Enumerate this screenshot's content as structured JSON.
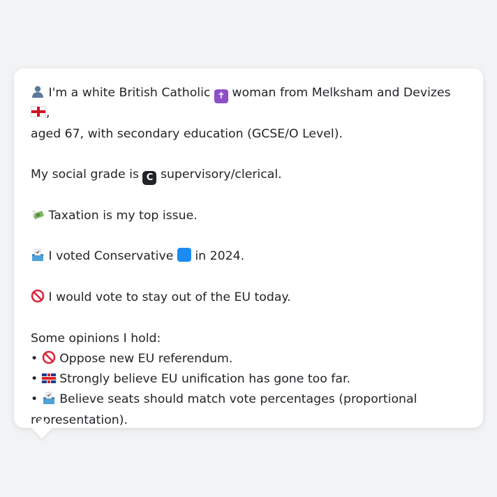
{
  "intro": {
    "person_icon": "person-silhouette-icon",
    "before_cross": "I'm a white British Catholic",
    "cross_icon": "latin-cross-icon",
    "after_cross": "woman from Melksham and Devizes",
    "flag_icon": "england-flag-icon",
    "after_flag": ",",
    "line2": "aged 67, with secondary education (GCSE/O Level)."
  },
  "social_grade": {
    "prefix": "My social grade is",
    "badge_letter": "C",
    "suffix": "supervisory/clerical."
  },
  "issue": {
    "icon": "money-with-wings-icon",
    "text": "Taxation is my top issue."
  },
  "vote": {
    "icon": "ballot-box-icon",
    "prefix": "I voted Conservative",
    "square_icon": "blue-square-icon",
    "suffix": "in 2024."
  },
  "eu": {
    "icon": "no-entry-icon",
    "text": "I would vote to stay out of the EU today."
  },
  "opinions": {
    "heading": "Some opinions I hold:",
    "bullet": "•",
    "items": [
      {
        "icon": "no-entry-icon",
        "text": "Oppose new EU referendum."
      },
      {
        "icon": "uk-flag-icon",
        "text": "Strongly believe EU unification has gone too far."
      },
      {
        "icon": "ballot-box-icon",
        "text": "Believe seats should match vote percentages (proportional representation)."
      }
    ]
  },
  "colors": {
    "background": "#f2f3f5",
    "bubble": "#ffffff",
    "text": "#222428",
    "accent_purple": "#8e4ec6",
    "accent_blue": "#1b8cf0"
  }
}
